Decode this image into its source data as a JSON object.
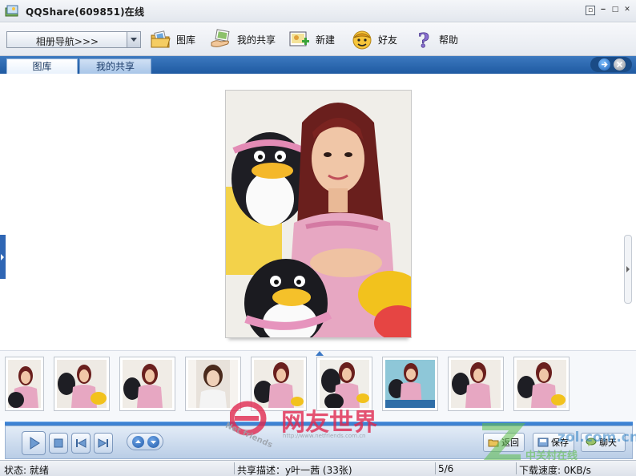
{
  "window": {
    "title": "QQShare(609851)在线",
    "controls": [
      "restore",
      "minimize",
      "maximize",
      "close"
    ]
  },
  "toolbar": {
    "nav_select": "相册导航>>>",
    "buttons": [
      {
        "label": "图库",
        "icon": "folder-photos-icon"
      },
      {
        "label": "我的共享",
        "icon": "share-hand-icon"
      },
      {
        "label": "新建",
        "icon": "new-album-icon"
      },
      {
        "label": "好友",
        "icon": "friend-face-icon"
      },
      {
        "label": "帮助",
        "icon": "help-question-icon"
      }
    ]
  },
  "tabs": [
    {
      "label": "图库",
      "active": true
    },
    {
      "label": "我的共享",
      "active": false
    }
  ],
  "filmstrip": {
    "thumbnail_count": 9
  },
  "player": {
    "back_label": "返回",
    "save_label": "保存",
    "chat_label": "聊天"
  },
  "watermarks": {
    "netfriends_cn": "网友世界",
    "netfriends_en": "Net friends",
    "netfriends_url": "http://www.netfriends.com.cn",
    "zol_cn": "中关村在线",
    "zol_url": "zol.com.cn"
  },
  "statusbar": {
    "status": "状态: 就绪",
    "share_desc": "共享描述：y叶一茜 (33张)",
    "page": "5/6",
    "download_speed": "下载速度: 0KB/s"
  },
  "colors": {
    "tab_bar": "#2a65ad",
    "progress": "#3e82d2",
    "watermark_red": "#e0284f",
    "watermark_green": "#5fbf4a"
  }
}
